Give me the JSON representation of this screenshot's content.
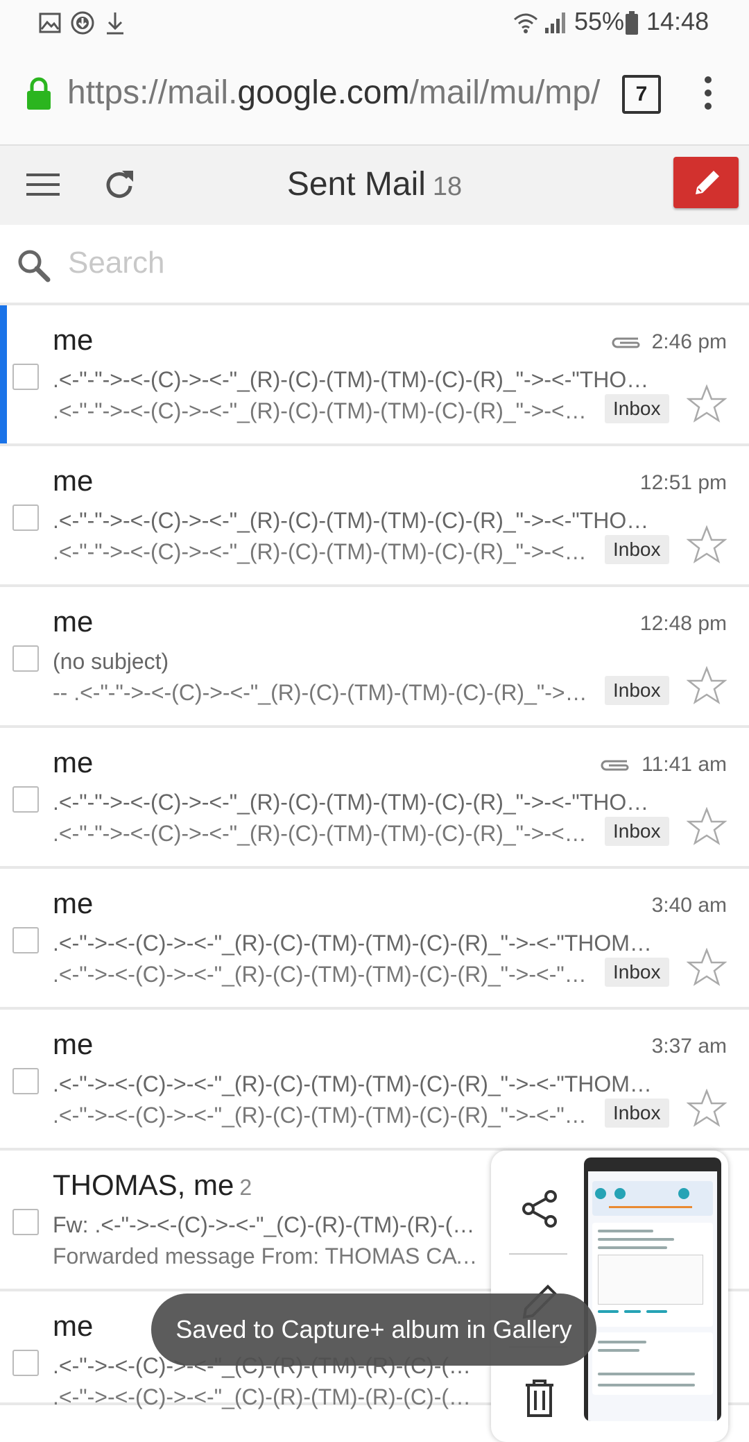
{
  "status_bar": {
    "battery": "55%",
    "time": "14:48"
  },
  "browser": {
    "url_prefix": "https://mail.",
    "url_domain": "google.com",
    "url_suffix": "/mail/mu/mp/",
    "tabs_count": "7"
  },
  "toolbar": {
    "title": "Sent Mail",
    "count": "18"
  },
  "search": {
    "placeholder": "Search"
  },
  "emails": [
    {
      "sender": "me",
      "thread_count": "",
      "time": "2:46 pm",
      "attachment": true,
      "subject": ".<-\"-\"->-<-(C)->-<-\"_(R)-(C)-(TM)-(TM)-(C)-(R)_\"->-<-\"THOMAS CATALANO\"->-<-\"_(R)-(C)-(TM)\"",
      "snippet": ".<-\"-\"->-<-(C)->-<-\"_(R)-(C)-(TM)-(TM)-(C)-(R)_\"->-<-\"THOMAS CATALANO\"",
      "label": "Inbox"
    },
    {
      "sender": "me",
      "thread_count": "",
      "time": "12:51 pm",
      "attachment": false,
      "subject": ".<-\"-\"->-<-(C)->-<-\"_(R)-(C)-(TM)-(TM)-(C)-(R)_\"->-<-\"THOMAS CATALANO\"->-<-\"_(R)-(C)-(TM)\"",
      "snippet": ".<-\"-\"->-<-(C)->-<-\"_(R)-(C)-(TM)-(TM)-(C)-(R)_\"->-<-\"THOMAS CATALANO\"",
      "label": "Inbox"
    },
    {
      "sender": "me",
      "thread_count": "",
      "time": "12:48 pm",
      "attachment": false,
      "subject": "(no subject)",
      "snippet": "-- .<-\"-\"->-<-(C)->-<-\"_(R)-(C)-(TM)-(TM)-(C)-(R)_\"->-<-\"THOMAS CATALANO\"",
      "label": "Inbox"
    },
    {
      "sender": "me",
      "thread_count": "",
      "time": "11:41 am",
      "attachment": true,
      "subject": ".<-\"-\"->-<-(C)->-<-\"_(R)-(C)-(TM)-(TM)-(C)-(R)_\"->-<-\"THOMAS CATALANO\"->-<-\"_(R)-(C)-(TM)\"",
      "snippet": ".<-\"-\"->-<-(C)->-<-\"_(R)-(C)-(TM)-(TM)-(C)-(R)_\"->-<-\"THOMAS CATALANO\"",
      "label": "Inbox"
    },
    {
      "sender": "me",
      "thread_count": "",
      "time": "3:40 am",
      "attachment": false,
      "subject": ".<-\"->-<-(C)->-<-\"_(R)-(C)-(TM)-(TM)-(C)-(R)_\"->-<-\"THOMAS CATALANO\"->-<-\"_(R)-(C)\"",
      "snippet": ".<-\"->-<-(C)->-<-\"_(R)-(C)-(TM)-(TM)-(C)-(R)_\"->-<-\"THOMAS CATALANO\"",
      "label": "Inbox"
    },
    {
      "sender": "me",
      "thread_count": "",
      "time": "3:37 am",
      "attachment": false,
      "subject": ".<-\"->-<-(C)->-<-\"_(R)-(C)-(TM)-(TM)-(C)-(R)_\"->-<-\"THOMAS CATALANO\"->-<-\"_(R)-(C)\"",
      "snippet": ".<-\"->-<-(C)->-<-\"_(R)-(C)-(TM)-(TM)-(C)-(R)_\"->-<-\"THOMAS CATALANO\"",
      "label": "Inbox"
    },
    {
      "sender": "THOMAS, me",
      "thread_count": "2",
      "time": "",
      "attachment": false,
      "subject": "Fw: .<-\"->-<-(C)->-<-\"_(C)-(R)-(TM)-(R)-(C)-(TM)_\"->-<-\"THOMAS CATALANO\"",
      "snippet": "Forwarded message From: THOMAS CATALANO",
      "label": ""
    },
    {
      "sender": "me",
      "thread_count": "",
      "time": "",
      "attachment": false,
      "subject": ".<-\"->-<-(C)->-<-\"_(C)-(R)-(TM)-(R)-(C)-(TM)_\"->-<-\"THOMAS CATALANO\"",
      "snippet": ".<-\"->-<-(C)->-<-\"_(C)-(R)-(TM)-(R)-(C)-(TM)_\"->-<-\"THOMAS CATALANO\"",
      "label": ""
    }
  ],
  "toast": {
    "message": "Saved to Capture+ album in Gallery"
  },
  "colors": {
    "compose": "#d2312e",
    "selected_bar": "#1a73e8",
    "lock": "#2bb51f"
  }
}
